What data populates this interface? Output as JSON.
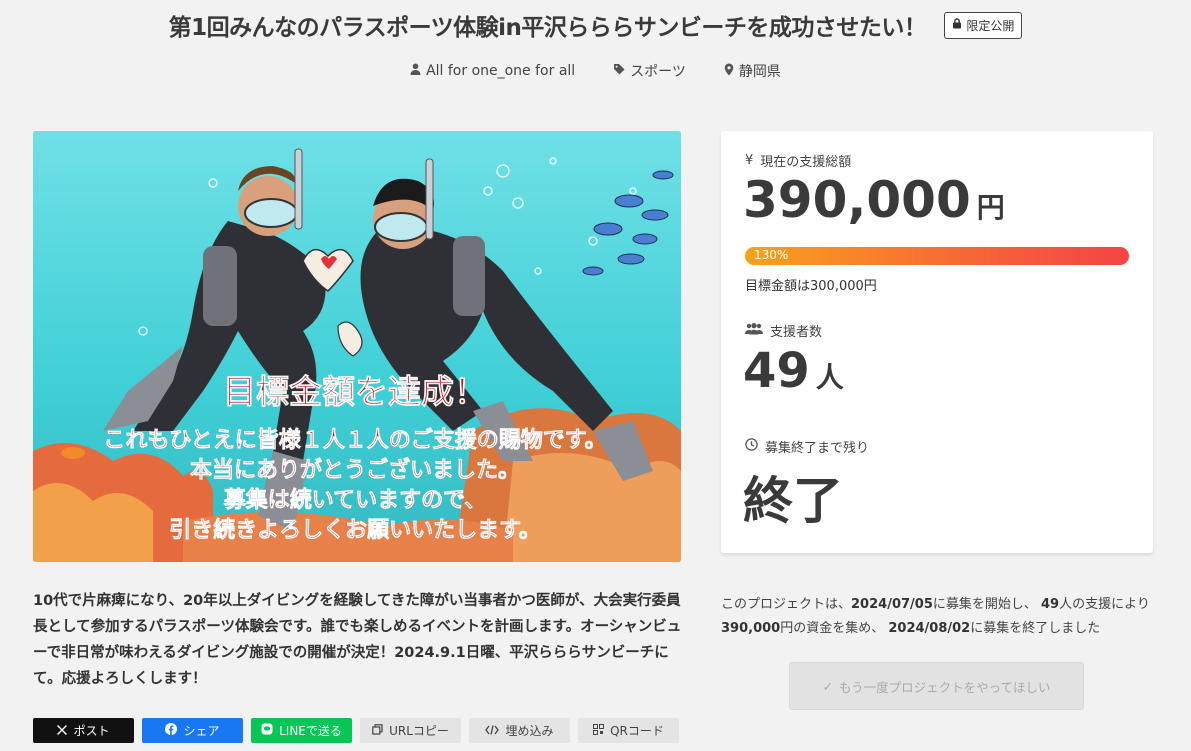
{
  "header": {
    "title": "第1回みんなのパラスポーツ体験in平沢らららサンビーチを成功させたい！",
    "badge": "限定公開",
    "owner": "All for one_one for all",
    "category": "スポーツ",
    "location": "静岡県"
  },
  "hero": {
    "icon": "project-illustration",
    "headline": "目標金額を達成！",
    "lines": [
      "これもひとえに皆様１人１人のご支援の賜物です。",
      "本当にありがとうございました。",
      "募集は続いていますので、",
      "引き続きよろしくお願いいたします。"
    ],
    "colors": {
      "sea": "#4fd6dd",
      "text": "#c8121b",
      "suit": "#2f3035"
    }
  },
  "description": "10代で片麻痺になり、20年以上ダイビングを経験してきた障がい当事者かつ医師が、大会実行委員長として参加するパラスポーツ体験会です。誰でも楽しめるイベントを計画します。オーシャンビューで非日常が味わえるダイビング施設での開催が決定！2024.9.1日曜、平沢らららサンビーチにて。応援よろしくします！",
  "share": {
    "post": "ポスト",
    "facebook": "シェア",
    "line": "LINEで送る",
    "url_copy": "URLコピー",
    "embed": "埋め込み",
    "qr": "QRコード"
  },
  "stats": {
    "total_label": "現在の支援総額",
    "total_value": "390,000",
    "total_unit": "円",
    "progress_text": "130%",
    "progress_percent": 130,
    "goal_text": "目標金額は300,000円",
    "supporters_label": "支援者数",
    "supporters_value": "49",
    "supporters_unit": "人",
    "remaining_label": "募集終了まで残り",
    "remaining_value": "終了"
  },
  "summary": {
    "p1": "このプロジェクトは、",
    "start_date": "2024/07/05",
    "p2": "に募集を開始し、 ",
    "supporters": "49",
    "p3": "人の支援により ",
    "amount": "390,000",
    "p4": "円の資金を集め、 ",
    "end_date": "2024/08/02",
    "p5": "に募集を終了しました"
  },
  "again_button": "もう一度プロジェクトをやってほしい",
  "colors": {
    "progress_start": "#f9a11b",
    "progress_end": "#f44444",
    "facebook": "#1877f2",
    "line": "#06c755"
  }
}
